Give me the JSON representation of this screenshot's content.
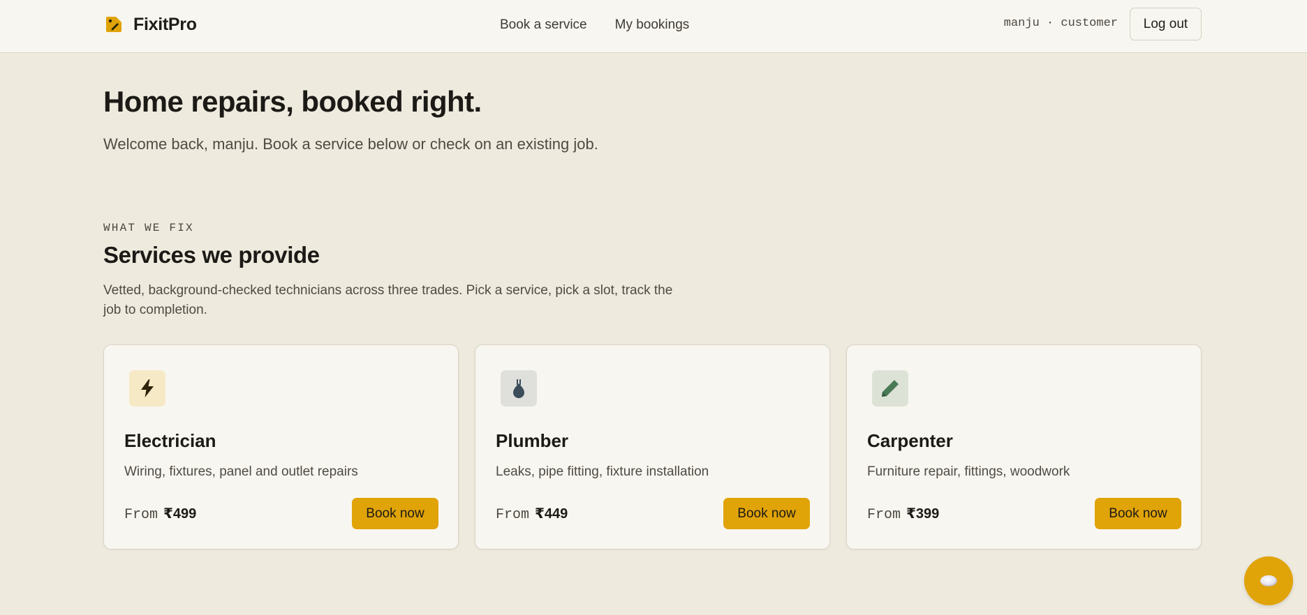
{
  "header": {
    "brand_name": "FixitPro",
    "brand_icon": "tag-icon",
    "nav": [
      {
        "label": "Book a service"
      },
      {
        "label": "My bookings"
      }
    ],
    "user_meta": "manju · customer",
    "logout_label": "Log out"
  },
  "hero": {
    "title": "Home repairs, booked right.",
    "subtitle": "Welcome back, manju. Book a service below or check on an existing job."
  },
  "services": {
    "eyebrow": "WHAT WE FIX",
    "title": "Services we provide",
    "description": "Vetted, background-checked technicians across three trades. Pick a service, pick a slot, track the job to completion.",
    "price_prefix": "From",
    "cta_label": "Book now",
    "items": [
      {
        "name": "Electrician",
        "description": "Wiring, fixtures, panel and outlet repairs",
        "price": "₹499",
        "icon": "lightning-bolt-icon",
        "icon_bg": "#f6e9c5",
        "icon_color": "#2b2208"
      },
      {
        "name": "Plumber",
        "description": "Leaks, pipe fitting, fixture installation",
        "price": "₹449",
        "icon": "water-drop-icon",
        "icon_bg": "#dfe0dc",
        "icon_color": "#3b4c5a"
      },
      {
        "name": "Carpenter",
        "description": "Furniture repair, fittings, woodwork",
        "price": "₹399",
        "icon": "pencil-icon",
        "icon_bg": "#dde2d6",
        "icon_color": "#4a7a55"
      }
    ]
  },
  "chat_fab": {
    "icon": "chat-bubble-icon"
  },
  "colors": {
    "background": "#eeeade",
    "surface": "#f8f6f0",
    "accent": "#e0a308",
    "text": "#1c1a16"
  }
}
